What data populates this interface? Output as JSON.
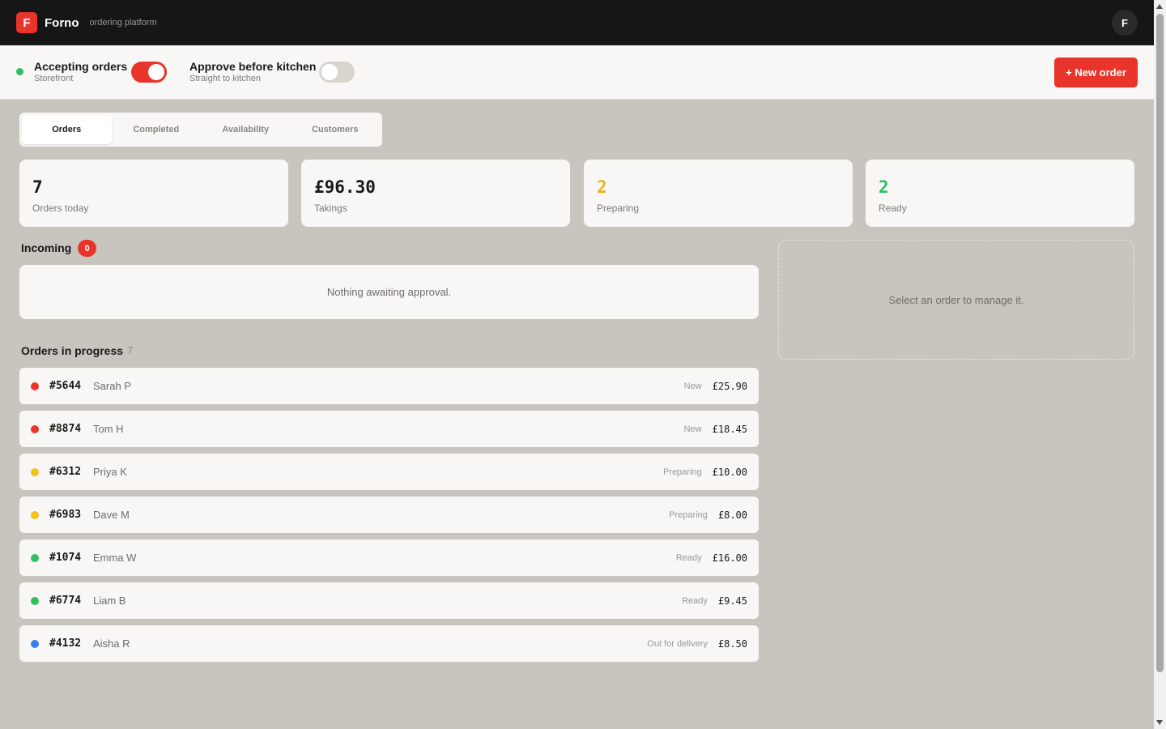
{
  "app": {
    "logo_letter": "F",
    "name": "Forno",
    "subtitle": "ordering platform",
    "user_initial": "F"
  },
  "controls": {
    "accepting": {
      "label": "Accepting orders",
      "sub": "Storefront",
      "on": true
    },
    "approve": {
      "label": "Approve before kitchen",
      "sub": "Straight to kitchen",
      "on": false
    },
    "new_order_label": "+ New order"
  },
  "tabs": [
    {
      "label": "Orders",
      "active": true
    },
    {
      "label": "Completed",
      "active": false
    },
    {
      "label": "Availability",
      "active": false
    },
    {
      "label": "Customers",
      "active": false
    }
  ],
  "stats": [
    {
      "value": "7",
      "label": "Orders today",
      "color": "#1a1a1a"
    },
    {
      "value": "£96.30",
      "label": "Takings",
      "color": "#1a1a1a"
    },
    {
      "value": "2",
      "label": "Preparing",
      "color": "#e5b51f"
    },
    {
      "value": "2",
      "label": "Ready",
      "color": "#2fbf62"
    }
  ],
  "incoming": {
    "title": "Incoming",
    "count": "0",
    "empty_text": "Nothing awaiting approval."
  },
  "progress": {
    "title": "Orders in progress",
    "count": "7"
  },
  "detail": {
    "placeholder": "Select an order to manage it."
  },
  "orders": [
    {
      "id": "#5644",
      "customer": "Sarah P",
      "status": "New",
      "amount": "£25.90",
      "color": "#e8342a"
    },
    {
      "id": "#8874",
      "customer": "Tom H",
      "status": "New",
      "amount": "£18.45",
      "color": "#e8342a"
    },
    {
      "id": "#6312",
      "customer": "Priya K",
      "status": "Preparing",
      "amount": "£10.00",
      "color": "#f1c21b"
    },
    {
      "id": "#6983",
      "customer": "Dave M",
      "status": "Preparing",
      "amount": "£8.00",
      "color": "#f1c21b"
    },
    {
      "id": "#1074",
      "customer": "Emma W",
      "status": "Ready",
      "amount": "£16.00",
      "color": "#2fbf62"
    },
    {
      "id": "#6774",
      "customer": "Liam B",
      "status": "Ready",
      "amount": "£9.45",
      "color": "#2fbf62"
    },
    {
      "id": "#4132",
      "customer": "Aisha R",
      "status": "Out for delivery",
      "amount": "£8.50",
      "color": "#3b7ef0"
    }
  ]
}
